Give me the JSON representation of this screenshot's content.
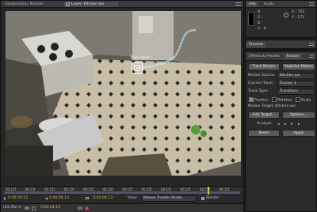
{
  "composition_panel": {
    "tab": "Composition: Kitchen"
  },
  "layer_panel": {
    "tab": "Layer: Kitchen.avi",
    "track_point_label": "Track Point 1",
    "ruler_ticks": [
      "00:15f",
      "00:15f",
      "00:15f",
      "00:15f",
      "00:15f",
      "00:15f",
      "00:15f",
      "00:15f",
      "00:15f",
      "00:15f",
      "00:15f",
      "00:15f"
    ],
    "start_time": "0:00:00:13",
    "end_time": "0:00:06:13",
    "duration": "0:00:06:13",
    "view_label": "View:",
    "view_value": "Motion Tracker Points",
    "render_label": "Render",
    "zoom": "(33.3%)",
    "current_time": "0:00:04:19"
  },
  "info_panel": {
    "tabs": [
      "Info",
      "Audio"
    ],
    "r": "R :",
    "g": "G :",
    "b": "B :",
    "a": "A : 0",
    "x": "X : 721",
    "y": "Y : 171"
  },
  "preview_panel": {
    "tab": "Preview"
  },
  "tracker_panel": {
    "tabs": [
      "Effects & Presets",
      "Tracker"
    ],
    "track_motion": "Track Motion",
    "stabilize_motion": "Stabilize Motion",
    "motion_source_label": "Motion Source:",
    "motion_source_value": "Kitchen.avi",
    "current_track_label": "Current Track:",
    "current_track_value": "Tracker 1",
    "track_type_label": "Track Type:",
    "track_type_value": "Transform",
    "position": "Position",
    "rotation": "Rotation",
    "scale": "Scale",
    "motion_target": "Motion Target: Kitchen.avi",
    "edit_target": "Edit Target...",
    "options": "Options...",
    "analyze_label": "Analyze:",
    "reset": "Reset",
    "apply": "Apply"
  }
}
